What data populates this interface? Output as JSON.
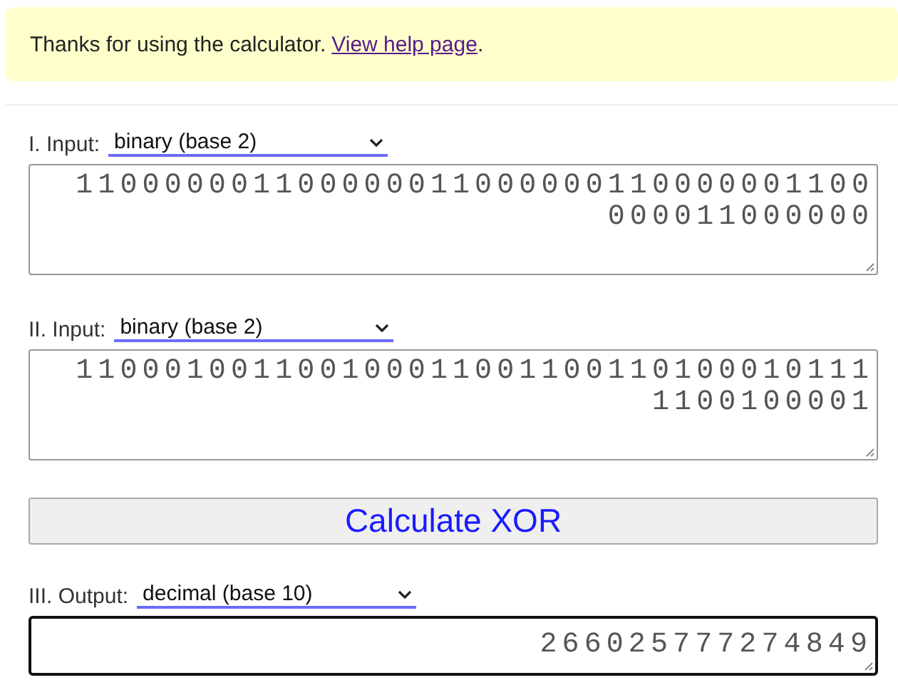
{
  "notice": {
    "text": "Thanks for using the calculator.",
    "link": "View help page",
    "after": "."
  },
  "inputs": [
    {
      "label": "I. Input:",
      "base": "binary (base 2)",
      "value": "110000001100000011000000110000001100000011000000",
      "focused": false
    },
    {
      "label": "II. Input:",
      "base": "binary (base 2)",
      "value": "1100010011001000110011001101000101111100100001",
      "focused": false
    }
  ],
  "button": "Calculate XOR",
  "output": {
    "label": "III. Output:",
    "base": "decimal (base 10)",
    "value": "266025777274849",
    "focused": true
  }
}
